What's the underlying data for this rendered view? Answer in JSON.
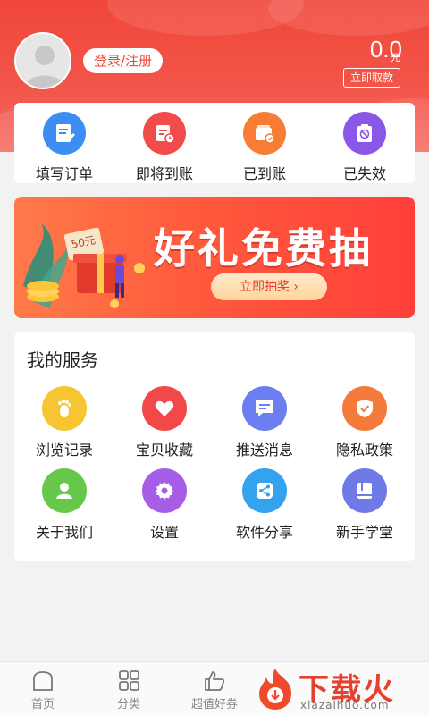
{
  "header": {
    "login_label": "登录/注册",
    "balance": "0.0",
    "balance_unit": "元",
    "withdraw_label": "立即取款",
    "accent_color": "#f0463a"
  },
  "orders": [
    {
      "label": "填写订单",
      "icon": "fill-order-icon",
      "color": "#3d8ef2"
    },
    {
      "label": "即将到账",
      "icon": "pending-bill-icon",
      "color": "#f24b4b"
    },
    {
      "label": "已到账",
      "icon": "wallet-received-icon",
      "color": "#f77d34"
    },
    {
      "label": "已失效",
      "icon": "expired-clipboard-icon",
      "color": "#8a57e8"
    }
  ],
  "banner": {
    "title": "好礼免费抽",
    "button_label": "立即抽奖 ›",
    "badge_text": "50元"
  },
  "services": {
    "title": "我的服务",
    "items": [
      {
        "label": "浏览记录",
        "icon": "footprint-icon",
        "color": "#f7c531"
      },
      {
        "label": "宝贝收藏",
        "icon": "heart-icon",
        "color": "#f2484a"
      },
      {
        "label": "推送消息",
        "icon": "message-icon",
        "color": "#6b7ff0"
      },
      {
        "label": "隐私政策",
        "icon": "shield-check-icon",
        "color": "#f47b3a"
      },
      {
        "label": "关于我们",
        "icon": "user-icon",
        "color": "#66c84a"
      },
      {
        "label": "设置",
        "icon": "gear-icon",
        "color": "#a65ee8"
      },
      {
        "label": "软件分享",
        "icon": "share-icon",
        "color": "#34a2ef"
      },
      {
        "label": "新手学堂",
        "icon": "book-icon",
        "color": "#6d7ae8"
      }
    ]
  },
  "tabbar": [
    {
      "label": "首页",
      "icon": "home-icon"
    },
    {
      "label": "分类",
      "icon": "category-grid-icon"
    },
    {
      "label": "超值好券",
      "icon": "thumbs-up-icon"
    }
  ],
  "watermark": {
    "text": "下载火",
    "sub": "xiazaihuo.com"
  }
}
